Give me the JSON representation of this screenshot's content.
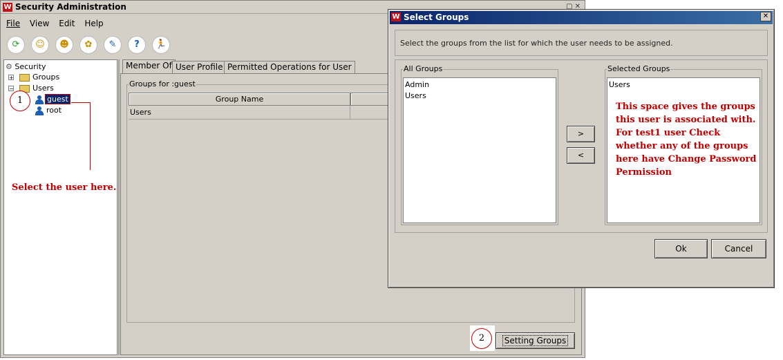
{
  "main_window": {
    "title": "Security Administration",
    "menu": [
      {
        "label": "File"
      },
      {
        "label": "View"
      },
      {
        "label": "Edit"
      },
      {
        "label": "Help"
      }
    ],
    "toolbar_icons": [
      "refresh-icon",
      "add-user-icon",
      "add-group-icon",
      "add-permission-icon",
      "edit-icon",
      "help-icon",
      "run-icon"
    ]
  },
  "tree": {
    "root": "Security",
    "groups": "Groups",
    "users": "Users",
    "user_items": [
      "guest",
      "root"
    ],
    "selected": "guest"
  },
  "tabs": [
    {
      "label": "Member Of",
      "active": true
    },
    {
      "label": "User Profile",
      "active": false
    },
    {
      "label": "Permitted Operations for User",
      "active": false
    }
  ],
  "groups_panel": {
    "legend": "Groups for :guest",
    "column_header": "Group Name",
    "rows": [
      "Users"
    ]
  },
  "setting_groups_button": "Setting Groups",
  "annotations": {
    "step1": "1",
    "step2": "2",
    "select_user": "Select the user here.",
    "selected_groups_note": [
      "This space gives the groups",
      "this user is associated with.",
      "For test1 user Check",
      "whether any of the groups",
      "here have Change Password",
      "Permission"
    ]
  },
  "dialog": {
    "title": "Select Groups",
    "instruction": "Select the groups from the list for which the user needs to be assigned.",
    "all_groups_label": "All Groups",
    "all_groups": [
      "Admin",
      "Users"
    ],
    "selected_groups_label": "Selected Groups",
    "selected_groups": [
      "Users"
    ],
    "add_button": ">",
    "remove_button": "<",
    "ok_button": "Ok",
    "cancel_button": "Cancel",
    "close_glyph": "✕"
  },
  "colors": {
    "window_bg": "#d4d0c8",
    "title_active": "#0a246a",
    "title_inactive": "#d4d0c8",
    "annotation_red": "#c00000"
  }
}
